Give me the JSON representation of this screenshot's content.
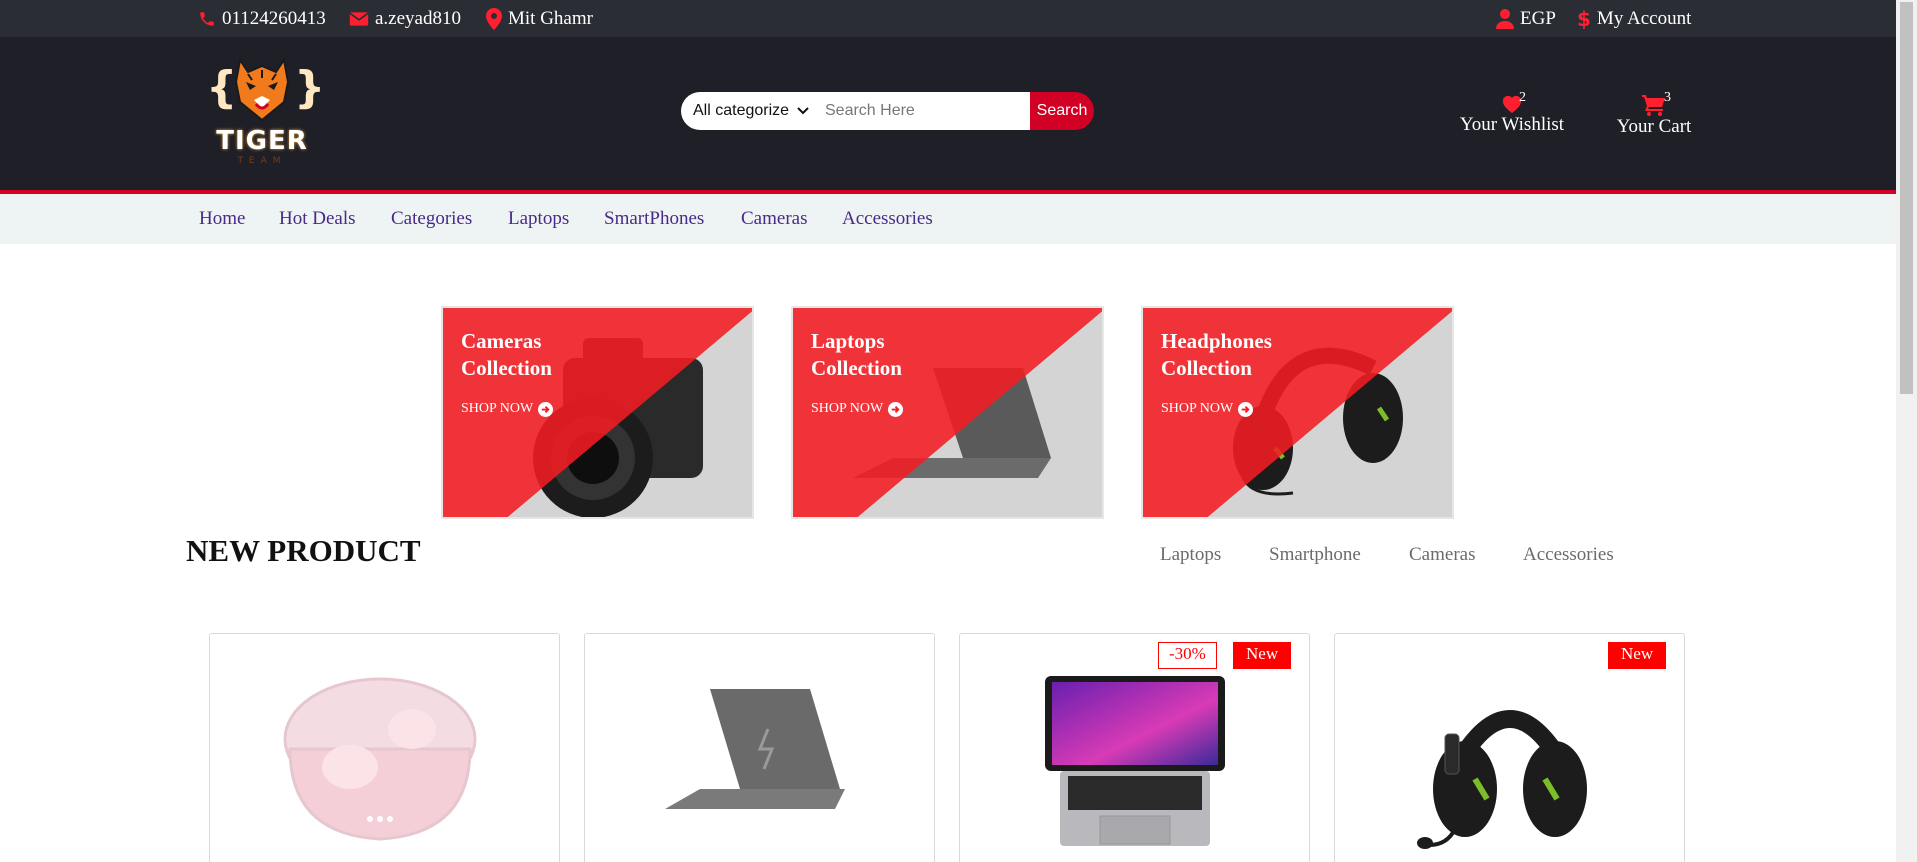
{
  "topbar": {
    "phone": "01124260413",
    "email": "a.zeyad810",
    "location": "Mit Ghamr",
    "currency": "EGP",
    "account": "My Account"
  },
  "logo": {
    "name": "TIGER",
    "sub": "TEAM"
  },
  "search": {
    "category_selected": "All categorize",
    "placeholder": "Search Here",
    "button": "Search"
  },
  "header": {
    "wishlist": {
      "label": "Your Wishlist",
      "count": "2"
    },
    "cart": {
      "label": "Your Cart",
      "count": "3"
    }
  },
  "nav": [
    "Home",
    "Hot Deals",
    "Categories",
    "Laptops",
    "SmartPhones",
    "Cameras",
    "Accessories"
  ],
  "banners": [
    {
      "line1": "Cameras",
      "line2": "Collection",
      "cta": "SHOP NOW",
      "image": "camera"
    },
    {
      "line1": "Laptops",
      "line2": "Collection",
      "cta": "SHOP NOW",
      "image": "laptop"
    },
    {
      "line1": "Headphones",
      "line2": "Collection",
      "cta": "SHOP NOW",
      "image": "headphones"
    }
  ],
  "new_product": {
    "title": "NEW PRODUCT",
    "tabs": [
      "Laptops",
      "Smartphone",
      "Cameras",
      "Accessories"
    ]
  },
  "products": [
    {
      "image": "pink-earbuds",
      "sale": "",
      "new": ""
    },
    {
      "image": "grey-laptop",
      "sale": "",
      "new": ""
    },
    {
      "image": "macbook-pro",
      "sale": "-30%",
      "new": "New"
    },
    {
      "image": "gaming-headset",
      "sale": "",
      "new": "New"
    }
  ],
  "colors": {
    "accent": "#d10024",
    "topbar": "#2b2d35",
    "header": "#1f1f28",
    "nav_bg": "#eef3f3",
    "nav_text": "#4a2a88",
    "banner_red": "#f21d22"
  }
}
